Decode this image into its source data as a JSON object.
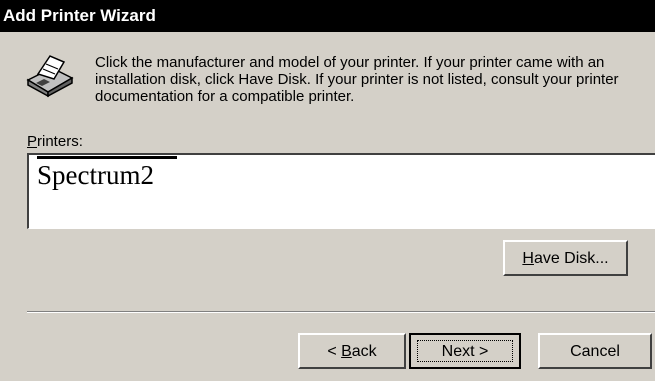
{
  "window": {
    "title": "Add Printer Wizard"
  },
  "header": {
    "icon": "printer-icon",
    "instructions": "Click the manufacturer and model of your printer. If your printer came with an installation disk, click Have Disk. If your printer is not listed, consult your printer documentation for a compatible printer."
  },
  "printers": {
    "label_accel": "P",
    "label_rest": "rinters:",
    "items": [
      "Spectrum2"
    ]
  },
  "buttons": {
    "have_disk_accel": "H",
    "have_disk_rest": "ave Disk...",
    "back_prefix": "< ",
    "back_accel": "B",
    "back_rest": "ack",
    "next": "Next >",
    "cancel": "Cancel"
  }
}
